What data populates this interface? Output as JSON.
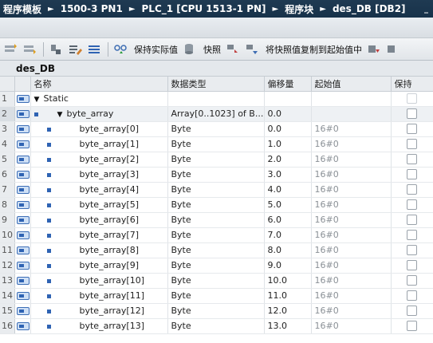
{
  "breadcrumb": [
    "程序模板",
    "1500-3 PN1",
    "PLC_1 [CPU 1513-1 PN]",
    "程序块",
    "des_DB [DB2]"
  ],
  "toolbar": {
    "keep_actual_label": "保持实际值",
    "snapshot_label": "快照",
    "copy_snapshot_label": "将快照值复制到起始值中"
  },
  "block": {
    "name": "des_DB"
  },
  "columns": {
    "name": "名称",
    "datatype": "数据类型",
    "offset": "偏移量",
    "start": "起始值",
    "retain": "保持"
  },
  "rows": [
    {
      "n": "1",
      "name": "Static",
      "type": "",
      "offset": "",
      "start": ""
    },
    {
      "n": "2",
      "name": "byte_array",
      "type": "Array[0..1023] of B...",
      "offset": "0.0",
      "start": ""
    },
    {
      "n": "3",
      "name": "byte_array[0]",
      "type": "Byte",
      "offset": "0.0",
      "start": "16#0"
    },
    {
      "n": "4",
      "name": "byte_array[1]",
      "type": "Byte",
      "offset": "1.0",
      "start": "16#0"
    },
    {
      "n": "5",
      "name": "byte_array[2]",
      "type": "Byte",
      "offset": "2.0",
      "start": "16#0"
    },
    {
      "n": "6",
      "name": "byte_array[3]",
      "type": "Byte",
      "offset": "3.0",
      "start": "16#0"
    },
    {
      "n": "7",
      "name": "byte_array[4]",
      "type": "Byte",
      "offset": "4.0",
      "start": "16#0"
    },
    {
      "n": "8",
      "name": "byte_array[5]",
      "type": "Byte",
      "offset": "5.0",
      "start": "16#0"
    },
    {
      "n": "9",
      "name": "byte_array[6]",
      "type": "Byte",
      "offset": "6.0",
      "start": "16#0"
    },
    {
      "n": "10",
      "name": "byte_array[7]",
      "type": "Byte",
      "offset": "7.0",
      "start": "16#0"
    },
    {
      "n": "11",
      "name": "byte_array[8]",
      "type": "Byte",
      "offset": "8.0",
      "start": "16#0"
    },
    {
      "n": "12",
      "name": "byte_array[9]",
      "type": "Byte",
      "offset": "9.0",
      "start": "16#0"
    },
    {
      "n": "13",
      "name": "byte_array[10]",
      "type": "Byte",
      "offset": "10.0",
      "start": "16#0"
    },
    {
      "n": "14",
      "name": "byte_array[11]",
      "type": "Byte",
      "offset": "11.0",
      "start": "16#0"
    },
    {
      "n": "15",
      "name": "byte_array[12]",
      "type": "Byte",
      "offset": "12.0",
      "start": "16#0"
    },
    {
      "n": "16",
      "name": "byte_array[13]",
      "type": "Byte",
      "offset": "13.0",
      "start": "16#0"
    }
  ]
}
